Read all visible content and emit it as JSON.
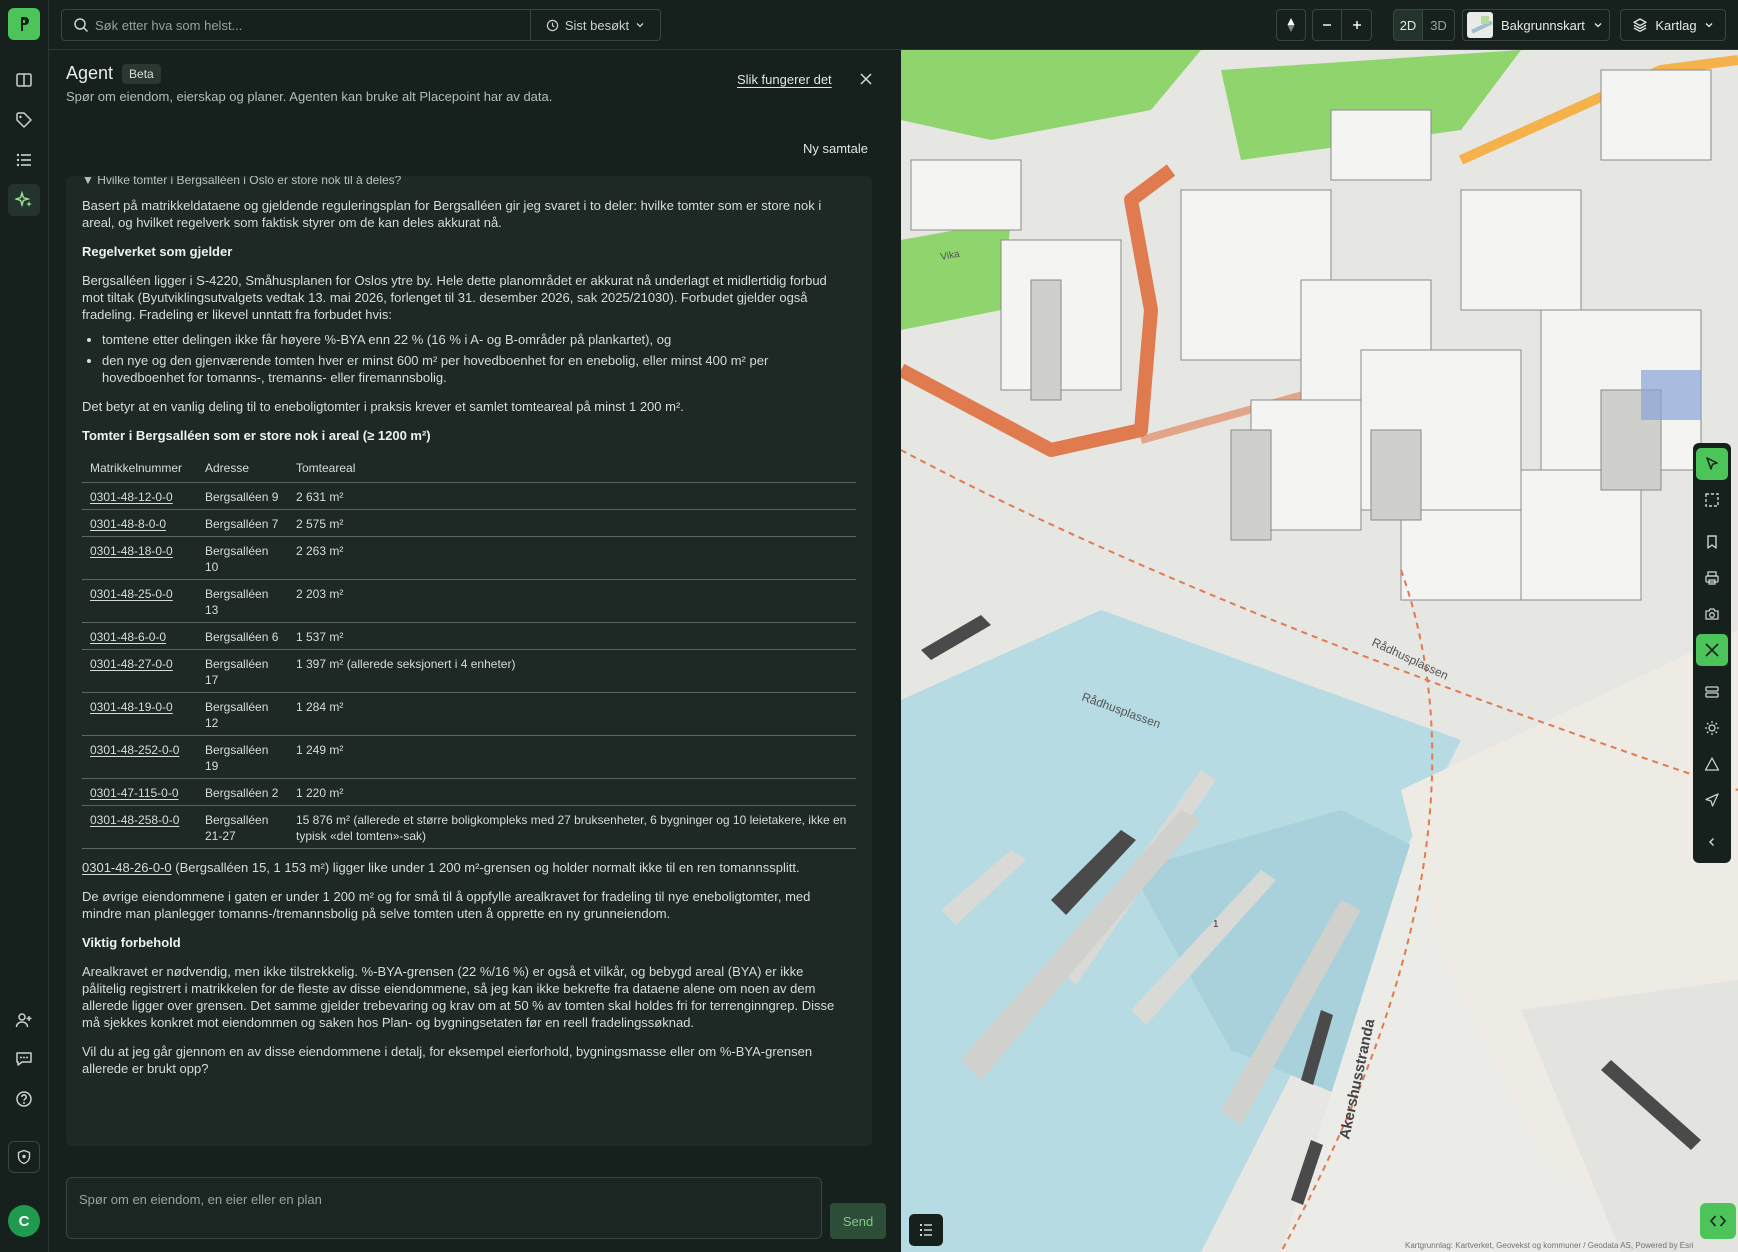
{
  "topbar": {
    "search_placeholder": "Søk etter hva som helst...",
    "recent_label": "Sist besøkt",
    "mode_2d": "2D",
    "mode_3d": "3D",
    "basemap_label": "Bakgrunnskart",
    "layers_label": "Kartlag"
  },
  "agent": {
    "title": "Agent",
    "badge": "Beta",
    "subtitle": "Spør om eiendom, eierskap og planer. Agenten kan bruke alt Placepoint har av data.",
    "how_link": "Slik fungerer det",
    "new_chat": "Ny samtale",
    "question": "▼ Hvilke tomter i Bergsalléen i Oslo er store nok til å deles?",
    "intro": "Basert på matrikkeldataene og gjeldende reguleringsplan for Bergsalléen gir jeg svaret i to deler: hvilke tomter som er store nok i areal, og hvilket regelverk som faktisk styrer om de kan deles akkurat nå.",
    "h_rules": "Regelverket som gjelder",
    "rules_text": "Bergsalléen ligger i S-4220, Småhusplanen for Oslos ytre by. Hele dette planområdet er akkurat nå underlagt et midlertidig forbud mot tiltak (Byutviklingsutvalgets vedtak 13. mai 2026, forlenget til 31. desember 2026, sak 2025/21030). Forbudet gjelder også fradeling. Fradeling er likevel unntatt fra forbudet hvis:",
    "bullets": [
      "tomtene etter delingen ikke får høyere %-BYA enn 22 % (16 % i A- og B-områder på plankartet), og",
      "den nye og den gjenværende tomten hver er minst 600 m² per hovedboenhet for en enebolig, eller minst 400 m² per hovedboenhet for tomanns-, tremanns- eller firemannsbolig."
    ],
    "meaning": "Det betyr at en vanlig deling til to eneboligtomter i praksis krever et samlet tomteareal på minst 1 200 m².",
    "h_table": "Tomter i Bergsalléen som er store nok i areal (≥ 1200 m²)",
    "table": {
      "headers": [
        "Matrikkelnummer",
        "Adresse",
        "Tomteareal"
      ],
      "rows": [
        [
          "0301-48-12-0-0",
          "Bergsalléen 9",
          "2 631 m²"
        ],
        [
          "0301-48-8-0-0",
          "Bergsalléen 7",
          "2 575 m²"
        ],
        [
          "0301-48-18-0-0",
          "Bergsalléen 10",
          "2 263 m²"
        ],
        [
          "0301-48-25-0-0",
          "Bergsalléen 13",
          "2 203 m²"
        ],
        [
          "0301-48-6-0-0",
          "Bergsalléen 6",
          "1 537 m²"
        ],
        [
          "0301-48-27-0-0",
          "Bergsalléen 17",
          "1 397 m² (allerede seksjonert i 4 enheter)"
        ],
        [
          "0301-48-19-0-0",
          "Bergsalléen 12",
          "1 284 m²"
        ],
        [
          "0301-48-252-0-0",
          "Bergsalléen 19",
          "1 249 m²"
        ],
        [
          "0301-47-115-0-0",
          "Bergsalléen 2",
          "1 220 m²"
        ],
        [
          "0301-48-258-0-0",
          "Bergsalléen 21-27",
          "15 876 m² (allerede et større boligkompleks med 27 bruksenheter, 6 bygninger og 10 leietakere, ikke en typisk «del tomten»-sak)"
        ]
      ]
    },
    "near_link": "0301-48-26-0-0",
    "near_text": " (Bergsalléen 15, 1 153 m²) ligger like under 1 200 m²-grensen og holder normalt ikke til en ren tomannssplitt.",
    "others": "De øvrige eiendommene i gaten er under 1 200 m² og for små til å oppfylle arealkravet for fradeling til nye eneboligtomter, med mindre man planlegger tomanns-/tremannsbolig på selve tomten uten å opprette en ny grunneiendom.",
    "h_caveat": "Viktig forbehold",
    "caveat": "Arealkravet er nødvendig, men ikke tilstrekkelig. %-BYA-grensen (22 %/16 %) er også et vilkår, og bebygd areal (BYA) er ikke pålitelig registrert i matrikkelen for de fleste av disse eiendommene, så jeg kan ikke bekrefte fra dataene alene om noen av dem allerede ligger over grensen. Det samme gjelder trebevaring og krav om at 50 % av tomten skal holdes fri for terrenginngrep. Disse må sjekkes konkret mot eiendommen og saken hos Plan- og bygningsetaten før en reell fradelingssøknad.",
    "followup": "Vil du at jeg går gjennom en av disse eiendommene i detalj, for eksempel eierforhold, bygningsmasse eller om %-BYA-grensen allerede er brukt opp?",
    "prompt_placeholder": "Spør om en eiendom, en eier eller en plan",
    "send_label": "Send"
  },
  "user": {
    "initial": "C"
  },
  "map": {
    "labels": [
      "Rådhusplassen",
      "Rådhusplassen",
      "Akershusstranda",
      "Vika"
    ],
    "pier_number": "1",
    "attribution": "Kartgrunnlag: Kartverket, Geovekst og kommuner / Geodata AS, Powered by Esri"
  },
  "colors": {
    "accent": "#4cc45a",
    "background": "#16201c",
    "water": "#b7dbe3",
    "park": "#8fd46c",
    "road": "#e07a4f"
  },
  "icons": {
    "rail": [
      "book-icon",
      "tag-icon",
      "list-icon",
      "sparkle-icon",
      "user-plus-icon",
      "chat-icon",
      "help-icon",
      "shield-icon"
    ],
    "tools": [
      "pointer-icon",
      "select-area-icon",
      "bookmark-icon",
      "print-icon",
      "camera-icon",
      "close-measure-icon",
      "layers-stack-icon",
      "sun-icon",
      "triangle-icon",
      "share-icon",
      "chevron-left-icon"
    ]
  }
}
